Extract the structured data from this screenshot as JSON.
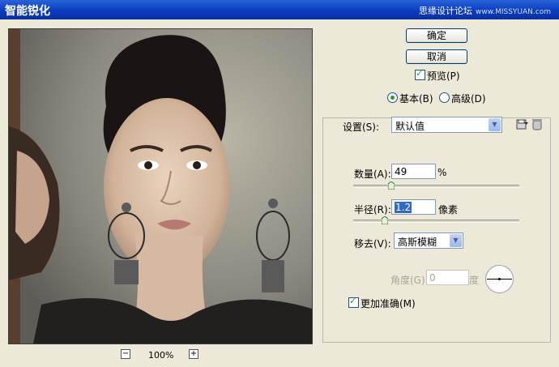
{
  "window": {
    "title": "智能锐化",
    "watermark": "思缘设计论坛",
    "watermark_site": "www.MISSYUAN.com"
  },
  "buttons": {
    "ok": "确定",
    "cancel": "取消"
  },
  "preview_toggle": {
    "label": "预览(P)",
    "checked": true
  },
  "mode": {
    "basic": "基本(B)",
    "advanced": "高级(D)",
    "selected": "basic"
  },
  "settings": {
    "label": "设置(S):",
    "value": "默认值"
  },
  "amount": {
    "label": "数量(A):",
    "value": "49",
    "unit": "%",
    "slider_fraction": 0.21
  },
  "radius": {
    "label": "半径(R):",
    "value": "1.2",
    "unit": "像素",
    "slider_fraction": 0.17
  },
  "remove": {
    "label": "移去(V):",
    "value": "高斯模糊"
  },
  "angle": {
    "label": "角度(G):",
    "value": "0",
    "unit": "度"
  },
  "more_accurate": {
    "label": "更加准确(M)",
    "checked": true
  },
  "zoom": {
    "level": "100%",
    "minus": "−",
    "plus": "+"
  },
  "colors": {
    "titlebar": "#0a3dc1",
    "accent_check": "#21a121",
    "highlight": "#316ac5"
  }
}
